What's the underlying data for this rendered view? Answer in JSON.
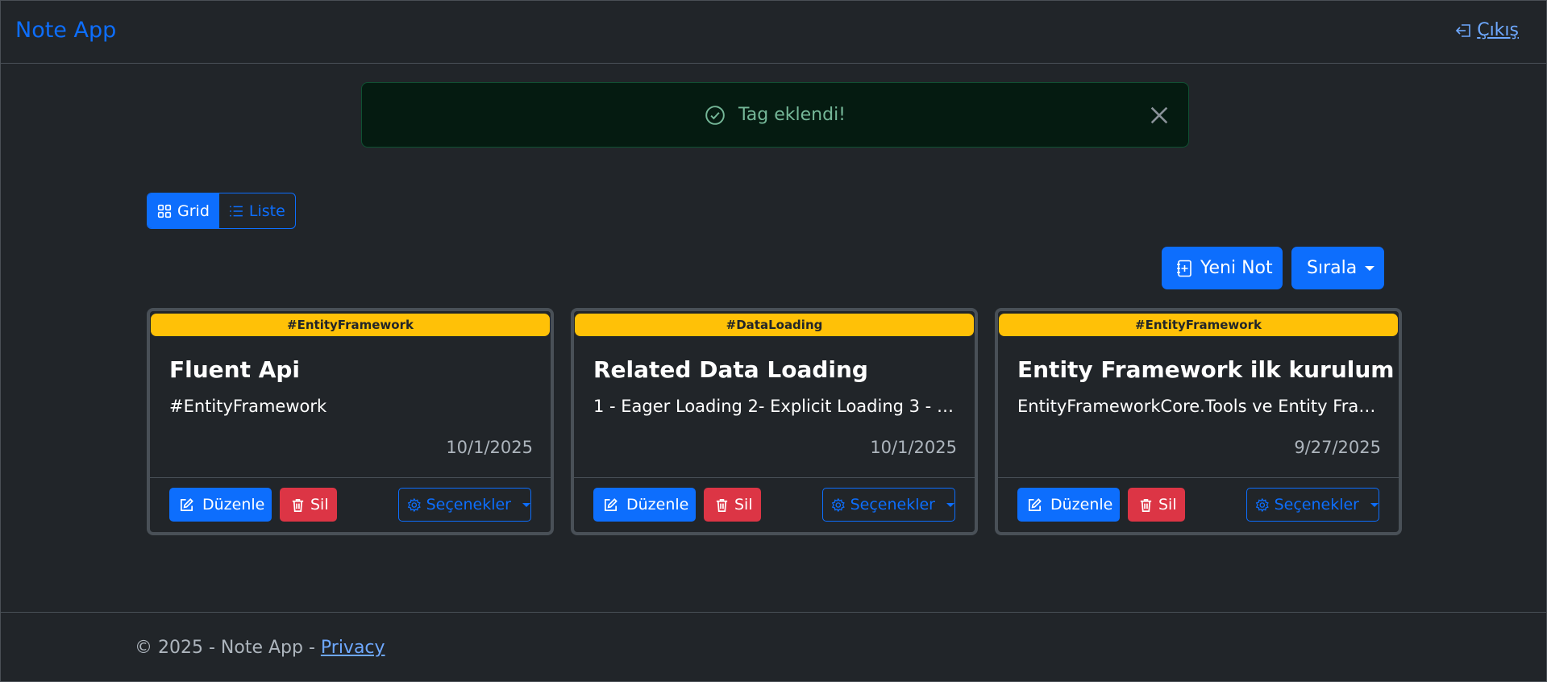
{
  "navbar": {
    "brand": "Note App",
    "logout_label": "Çıkış"
  },
  "alert": {
    "message": "Tag eklendi!"
  },
  "view_toggle": {
    "grid_label": "Grid",
    "list_label": "Liste"
  },
  "actions": {
    "new_note_label": "Yeni Not",
    "sort_label": "Sırala"
  },
  "cards": [
    {
      "tag": "#EntityFramework",
      "title": "Fluent Api",
      "text": "#EntityFramework",
      "date": "10/1/2025",
      "edit_label": "Düzenle",
      "delete_label": "Sil",
      "options_label": "Seçenekler"
    },
    {
      "tag": "#DataLoading",
      "title": "Related Data Loading",
      "text": "1 - Eager Loading 2- Explicit Loading 3 - L...",
      "date": "10/1/2025",
      "edit_label": "Düzenle",
      "delete_label": "Sil",
      "options_label": "Seçenekler"
    },
    {
      "tag": "#EntityFramework",
      "title": "Entity Framework ilk kurulum",
      "text": "EntityFrameworkCore.Tools ve Entity Fram...",
      "date": "9/27/2025",
      "edit_label": "Düzenle",
      "delete_label": "Sil",
      "options_label": "Seçenekler"
    }
  ],
  "footer": {
    "copyright": "© 2025 - Note App - ",
    "privacy_label": "Privacy"
  }
}
